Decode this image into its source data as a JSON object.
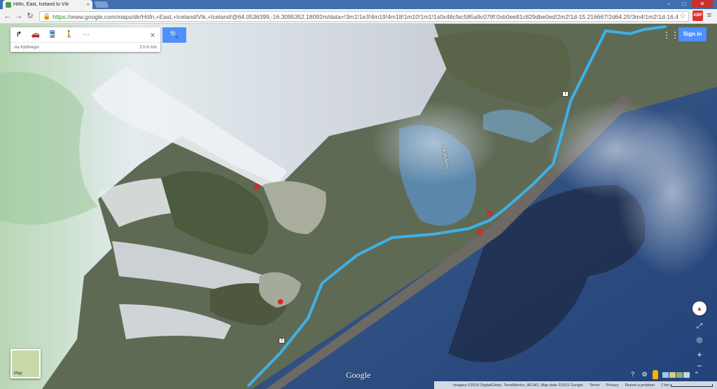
{
  "browser": {
    "tab_title": "Höfn, East, Iceland to Vík",
    "tab_close": "×",
    "url_secure": "https://",
    "url_rest": "www.google.com/maps/dir/Höfn,+East,+Iceland/Vík,+Iceland/@64.0536399,-16.3095352,18092m/data=!3m1!1e3!4m19!4m18!1m10!1m1!1s0x48cfac585a9c079f:0xb0ee81c829dbe0ed!2m2!1d-15.216667!2d64.25!3m4!1m2!1d-16.4",
    "nav_back": "←",
    "nav_forward": "→",
    "nav_reload": "↻",
    "star": "☆",
    "ext_label": "ABP",
    "menu": "≡",
    "win_minimize": "–",
    "win_maximize": "□",
    "win_close": "✕",
    "icons": {
      "favicon": "maps-favicon-icon",
      "lock": "lock-icon"
    }
  },
  "directions": {
    "modes": [
      {
        "name": "directions",
        "glyph": "↱"
      },
      {
        "name": "car",
        "glyph": "🚗"
      },
      {
        "name": "transit",
        "glyph": "🚆"
      },
      {
        "name": "walk",
        "glyph": "🚶"
      },
      {
        "name": "more",
        "glyph": "···"
      }
    ],
    "close": "×",
    "route_via": "via Þjóðvegur",
    "route_time": "3 h 8 min",
    "search_glyph": "🔍"
  },
  "header": {
    "apps_glyph": "⋮⋮⋮",
    "signin": "Sign in"
  },
  "map": {
    "route_color": "#3fb0e6",
    "marker_color": "#e22222",
    "shields": [
      {
        "label": "1"
      },
      {
        "label": "1"
      }
    ],
    "lake_label": "Jökulsárlón",
    "thumb_label": "Map",
    "google": "Google",
    "compass_glyph": "▲",
    "tilt_glyph": "⤢",
    "location_glyph": "◎",
    "zoom_in": "+",
    "zoom_out": "−",
    "help_glyph": "?",
    "settings_glyph": "⚙",
    "expand_glyph": "⌃"
  },
  "footer": {
    "imagery": "Imagery ©2015 DigitalGlobe, TerraMetrics, IBCAO, Map data ©2015 Google",
    "terms": "Terms",
    "privacy": "Privacy",
    "report": "Report a problem",
    "scale": "2 km"
  }
}
